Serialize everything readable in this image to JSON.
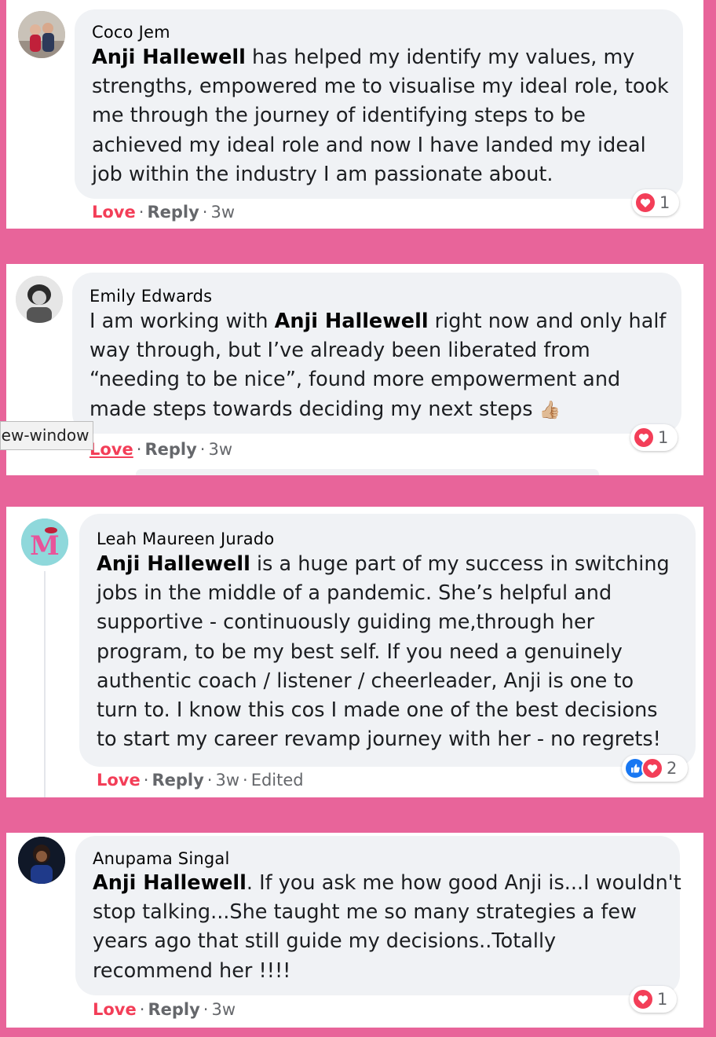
{
  "colors": {
    "page_bg": "#e8649a",
    "love": "#f33e58",
    "like": "#1877f2",
    "muted": "#65676b",
    "bubble": "#f0f2f5"
  },
  "comments": [
    {
      "author": "Coco Jem",
      "mention": "Anji Hallewell",
      "text_lines": [
        " has helped my identify my values, my",
        "strengths, empowered me to visualise my ideal role, took",
        "me through the journey of identifying steps to be",
        "achieved my ideal role and now I have landed my ideal",
        "job within the industry I am passionate about."
      ],
      "love_label": "Love",
      "reply_label": "Reply",
      "time": "3w",
      "reaction_count": "1",
      "reactions": [
        "heart-icon"
      ]
    },
    {
      "author": "Emily Edwards",
      "text_prefix": "I am working with ",
      "mention": "Anji Hallewell",
      "text_lines": [
        " right now and only half",
        "way through, but I’ve already been liberated from",
        "“needing to be nice”, found more empowerment and",
        "made steps towards deciding my next steps"
      ],
      "emoji": "👍🏼",
      "love_label": "Love",
      "reply_label": "Reply",
      "time": "3w",
      "reaction_count": "1",
      "reactions": [
        "heart-icon"
      ]
    },
    {
      "author": "Leah Maureen Jurado",
      "avatar_letter": "M",
      "mention": "Anji Hallewell",
      "text_lines": [
        " is a huge part of my success in switching",
        "jobs in the middle of a pandemic. She’s helpful and",
        "supportive - continuously guiding me,through her",
        "program, to be my best self. If you need a genuinely",
        "authentic coach / listener / cheerleader, Anji is one to",
        "turn to. I know this cos I made one of the best decisions",
        "to start my career revamp journey with her - no regrets!"
      ],
      "love_label": "Love",
      "reply_label": "Reply",
      "time": "3w",
      "edited": "Edited",
      "reaction_count": "2",
      "reactions": [
        "like-icon",
        "heart-icon"
      ]
    },
    {
      "author": "Anupama Singal",
      "mention": "Anji Hallewell",
      "text_lines": [
        ". If you ask me how good Anji is...I wouldn't",
        "stop talking...She taught me so many strategies a few",
        "years ago that still guide my decisions..Totally",
        "recommend her !!!!"
      ],
      "love_label": "Love",
      "reply_label": "Reply",
      "time": "3w",
      "reaction_count": "1",
      "reactions": [
        "heart-icon"
      ]
    }
  ],
  "tooltip": {
    "text": "new-window"
  },
  "separator": "·"
}
